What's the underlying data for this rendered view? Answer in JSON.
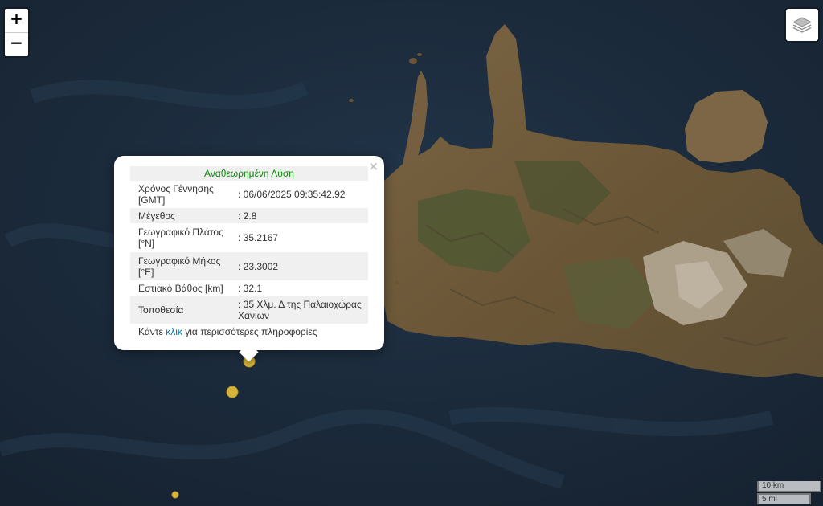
{
  "zoom": {
    "in_label": "+",
    "out_label": "−"
  },
  "icons": {
    "layers": "layers-icon",
    "close": "close-icon"
  },
  "popup": {
    "close_label": "×",
    "status": "Αναθεωρημένη Λύση",
    "rows": [
      {
        "label": "Χρόνος Γέννησης [GMT]",
        "value": ": 06/06/2025 09:35:42.92"
      },
      {
        "label": "Μέγεθος",
        "value": ": 2.8"
      },
      {
        "label": "Γεωγραφικό Πλάτος [°N]",
        "value": ": 35.2167"
      },
      {
        "label": "Γεωγραφικό Μήκος [°E]",
        "value": ": 23.3002"
      },
      {
        "label": "Εστιακό Βάθος [km]",
        "value": ": 32.1"
      },
      {
        "label": "Τοποθεσία",
        "value": ": 35 Χλμ. Δ της Παλαιοχώρας Χανίων"
      }
    ],
    "more_prefix": "Κάντε",
    "more_link": "κλικ",
    "more_suffix": "για περισσότερες πληροφορίες"
  },
  "scale": {
    "metric": "10 km",
    "imperial": "5 mi"
  },
  "colors": {
    "sea": "#1b2a3a",
    "land": "#6e5a3c",
    "vegetation": "#4c5430",
    "mountain": "#b7ad9d",
    "epicenter": "#d6b43c",
    "status_text": "#0a8a0a",
    "link": "#0078a8"
  }
}
